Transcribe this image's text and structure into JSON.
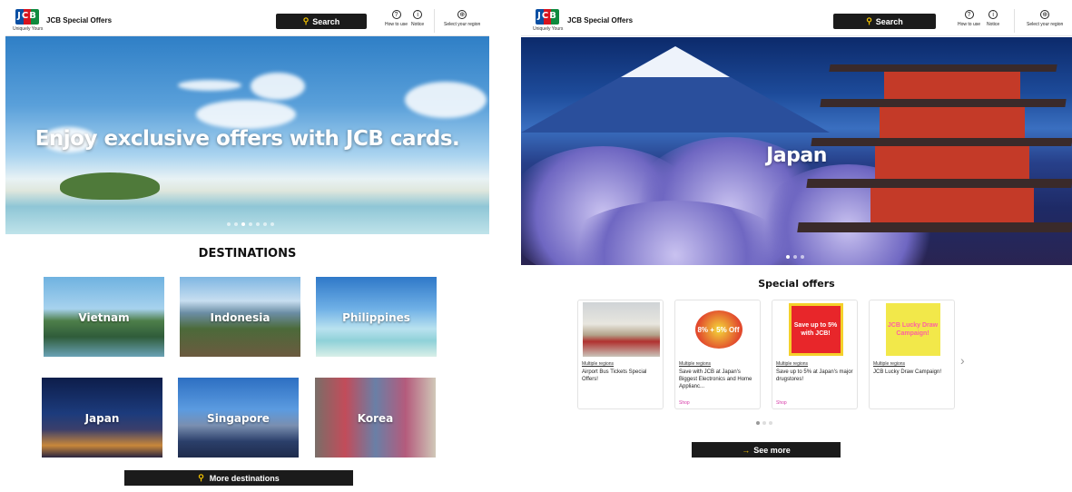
{
  "left": {
    "header": {
      "brand": "JCB Special Offers",
      "logo_text": "JCB",
      "tagline": "Uniquely Yours",
      "search_label": "Search",
      "how_to_use": "How to use",
      "notice": "Notice",
      "region": "Select your region"
    },
    "hero": {
      "headline": "Enjoy exclusive offers with JCB cards."
    },
    "destinations": {
      "title": "DESTINATIONS",
      "items": [
        {
          "label": "Vietnam"
        },
        {
          "label": "Indonesia"
        },
        {
          "label": "Philippines"
        },
        {
          "label": "Japan"
        },
        {
          "label": "Singapore"
        },
        {
          "label": "Korea"
        }
      ],
      "more_label": "More destinations"
    }
  },
  "right": {
    "header": {
      "brand": "JCB Special Offers",
      "logo_text": "JCB",
      "tagline": "Uniquely Yours",
      "search_label": "Search",
      "how_to_use": "How to use",
      "notice": "Notice",
      "region": "Select your region"
    },
    "hero": {
      "headline": "Japan"
    },
    "special_offers": {
      "title": "Special offers",
      "cards": [
        {
          "region": "Multiple regions",
          "desc": "Airport Bus Tickets Special Offers!",
          "category": "",
          "image_text": ""
        },
        {
          "region": "Multiple regions",
          "desc": "Save with JCB at Japan's Biggest Electronics and Home Applianc...",
          "category": "Shop",
          "image_text": "8% + 5% Off"
        },
        {
          "region": "Multiple regions",
          "desc": "Save up to 5% at Japan's major drugstores!",
          "category": "Shop",
          "image_text": "Save up to 5% with JCB!"
        },
        {
          "region": "Multiple regions",
          "desc": "JCB Lucky Draw Campaign!",
          "category": "",
          "image_text": "JCB Lucky Draw Campaign!"
        }
      ],
      "see_more_label": "See more"
    }
  },
  "colors": {
    "button_bg": "#1b1b1b",
    "accent": "#f5c400",
    "category": "#d63aa8"
  },
  "icons": [
    "search-icon",
    "help-icon",
    "info-icon",
    "globe-icon",
    "location-pin-icon",
    "arrow-right-icon",
    "chevron-right-icon"
  ]
}
